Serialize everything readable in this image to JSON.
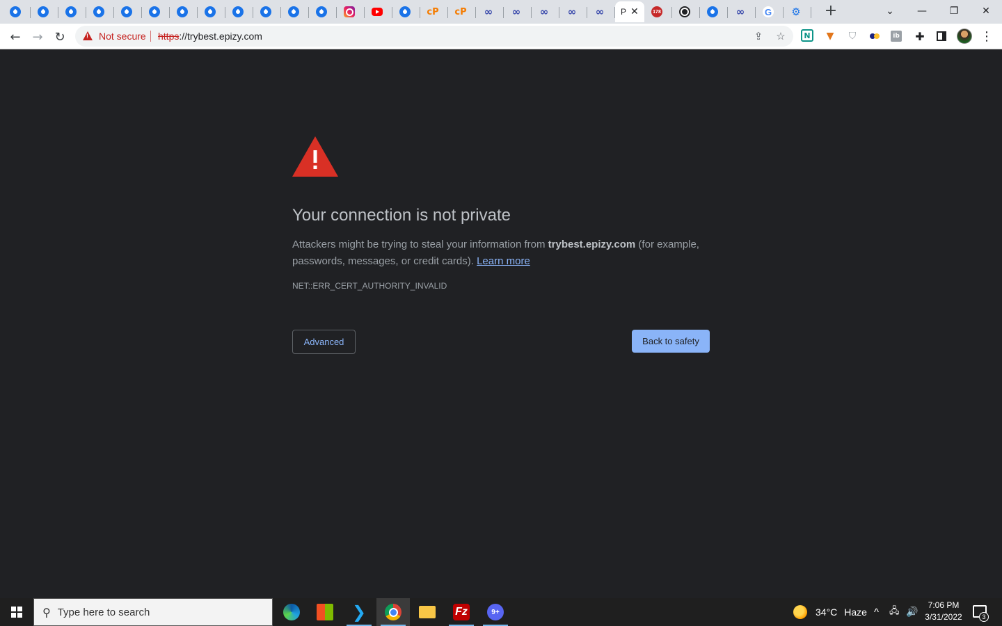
{
  "browser": {
    "tabs": [
      {
        "icon": "drop-icon"
      },
      {
        "icon": "drop-icon"
      },
      {
        "icon": "drop-icon"
      },
      {
        "icon": "drop-icon"
      },
      {
        "icon": "drop-icon"
      },
      {
        "icon": "drop-icon"
      },
      {
        "icon": "drop-icon"
      },
      {
        "icon": "drop-icon"
      },
      {
        "icon": "drop-icon"
      },
      {
        "icon": "drop-icon"
      },
      {
        "icon": "drop-icon"
      },
      {
        "icon": "drop-icon"
      },
      {
        "icon": "instagram-icon"
      },
      {
        "icon": "youtube-icon"
      },
      {
        "icon": "drop-icon"
      },
      {
        "icon": "cp-icon",
        "glyph": "cP"
      },
      {
        "icon": "cp-icon",
        "glyph": "cP"
      },
      {
        "icon": "infinity-icon",
        "glyph": "∞"
      },
      {
        "icon": "infinity-icon",
        "glyph": "∞"
      },
      {
        "icon": "infinity-icon",
        "glyph": "∞"
      },
      {
        "icon": "infinity-icon",
        "glyph": "∞"
      },
      {
        "icon": "infinity-icon",
        "glyph": "∞"
      },
      {
        "icon": "active",
        "title": "P",
        "close": "✕"
      },
      {
        "icon": "badge-icon",
        "glyph": "178"
      },
      {
        "icon": "globe-icon"
      },
      {
        "icon": "drop-icon"
      },
      {
        "icon": "infinity-icon",
        "glyph": "∞"
      },
      {
        "icon": "google-icon",
        "glyph": "G"
      },
      {
        "icon": "gear-icon",
        "glyph": "⚙"
      }
    ],
    "new_tab": "+",
    "window_controls": {
      "tab_search": "⌄",
      "minimize": "—",
      "restore": "❐",
      "close": "✕"
    },
    "nav": {
      "back": "←",
      "forward": "→",
      "reload": "↻"
    },
    "address_bar": {
      "security_label": "Not secure",
      "url_scheme": "https",
      "url_rest": "://trybest.epizy.com"
    },
    "toolbar_icons": {
      "share": "⇪",
      "bookmark": "☆",
      "extensions": "✚",
      "sidebar": "▮",
      "menu": "⋮"
    }
  },
  "page": {
    "heading": "Your connection is not private",
    "desc_before": "Attackers might be trying to steal your information from ",
    "desc_host": "trybest.epizy.com",
    "desc_after": " (for example, passwords, messages, or credit cards). ",
    "learn_more": "Learn more",
    "error_code": "NET::ERR_CERT_AUTHORITY_INVALID",
    "advanced_button": "Advanced",
    "back_button": "Back to safety",
    "colors": {
      "warning": "#d93025",
      "link": "#8ab4f8",
      "background": "#202124"
    }
  },
  "taskbar": {
    "search_placeholder": "Type here to search",
    "apps": [
      "edge-icon",
      "store-icon",
      "vscode-icon",
      "chrome-icon",
      "folder-icon",
      "filezilla-icon",
      "discord-icon"
    ],
    "filezilla_glyph": "Fz",
    "discord_badge": "9+",
    "weather_temp": "34°C",
    "weather_desc": "Haze",
    "tray_chevron": "^",
    "time": "7:06 PM",
    "date": "3/31/2022",
    "notification_count": "3"
  }
}
